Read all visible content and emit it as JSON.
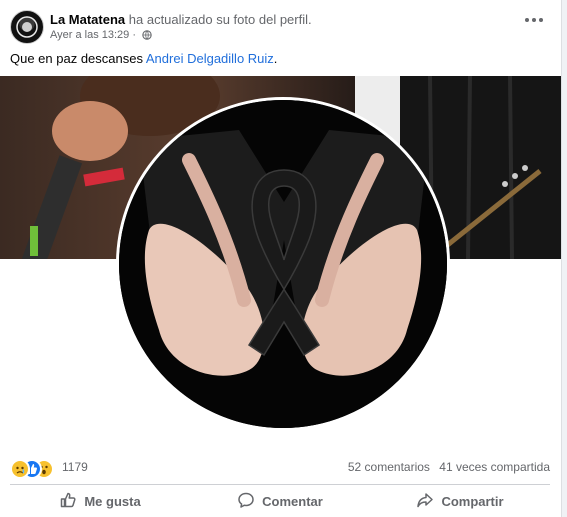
{
  "post": {
    "author": "La Matatena",
    "action": "ha actualizado su foto del perfil.",
    "timestamp": "Ayer a las 13:29",
    "separator": "·",
    "audience_icon": "globe-icon",
    "caption_text": "Que en paz descanses",
    "caption_link": "Andrei Delgadillo Ruiz",
    "caption_end": "."
  },
  "stats": {
    "reactions": [
      "sad",
      "like",
      "wow"
    ],
    "reaction_count": "1179",
    "comments": "52 comentarios",
    "shares": "41 veces compartida"
  },
  "actions": {
    "like": "Me gusta",
    "comment": "Comentar",
    "share": "Compartir"
  },
  "colors": {
    "link": "#216fdb",
    "secondary_text": "#65676b",
    "like_blue": "#1877f2"
  }
}
